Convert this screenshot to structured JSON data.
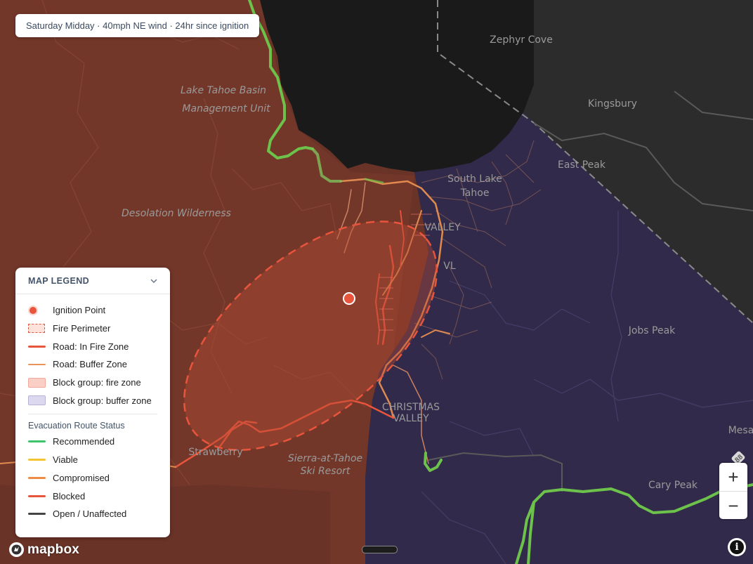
{
  "status_bar": {
    "text": "Saturday Midday · 40mph NE wind · 24hr since ignition"
  },
  "map": {
    "labels": {
      "zephyr_cove": "Zephyr Cove",
      "kingsbury": "Kingsbury",
      "east_peak": "East Peak",
      "lake_tahoe_basin_line1": "Lake Tahoe Basin",
      "lake_tahoe_basin_line2": "Management Unit",
      "south_lake_line1": "South Lake",
      "south_lake_line2": "Tahoe",
      "desolation": "Desolation Wilderness",
      "jobs_peak": "Jobs Peak",
      "christmas_line1": "CHRISTMAS",
      "christmas_line2": "VALLEY",
      "sierra_line1": "Sierra-at-Tahoe",
      "sierra_line2": "Ski Resort",
      "strawberry": "Strawberry",
      "cary_peak": "Cary Peak",
      "mesa": "Mesa",
      "valley": "VALLEY",
      "vl": "VL",
      "shield_88": "88"
    },
    "colors": {
      "lake": "#1b1b1b",
      "land": "#2c2c2c",
      "fire_zone": "#6a3327",
      "buffer_zone": "#312a4a",
      "road_fire": "#e8553c",
      "road_buffer": "#e08a4f",
      "recommended": "#6cc24a",
      "ignition": "#e8553c"
    }
  },
  "legend": {
    "title": "MAP LEGEND",
    "items": [
      {
        "label": "Ignition Point"
      },
      {
        "label": "Fire Perimeter"
      },
      {
        "label": "Road: In Fire Zone",
        "color": "#e8553c"
      },
      {
        "label": "Road: Buffer Zone",
        "color": "#e8945a"
      },
      {
        "label": "Block group: fire zone",
        "color": "#f9cfc6"
      },
      {
        "label": "Block group: buffer zone",
        "color": "#dcd8ef"
      }
    ],
    "route_title": "Evacuation Route Status",
    "routes": [
      {
        "label": "Recommended",
        "color": "#3ec46d"
      },
      {
        "label": "Viable",
        "color": "#f5c431"
      },
      {
        "label": "Compromised",
        "color": "#ee8b45"
      },
      {
        "label": "Blocked",
        "color": "#e8553c"
      },
      {
        "label": "Open / Unaffected",
        "color": "#444444"
      }
    ]
  },
  "controls": {
    "zoom_in": "+",
    "zoom_out": "−",
    "info": "i"
  },
  "attribution": {
    "brand": "mapbox"
  }
}
